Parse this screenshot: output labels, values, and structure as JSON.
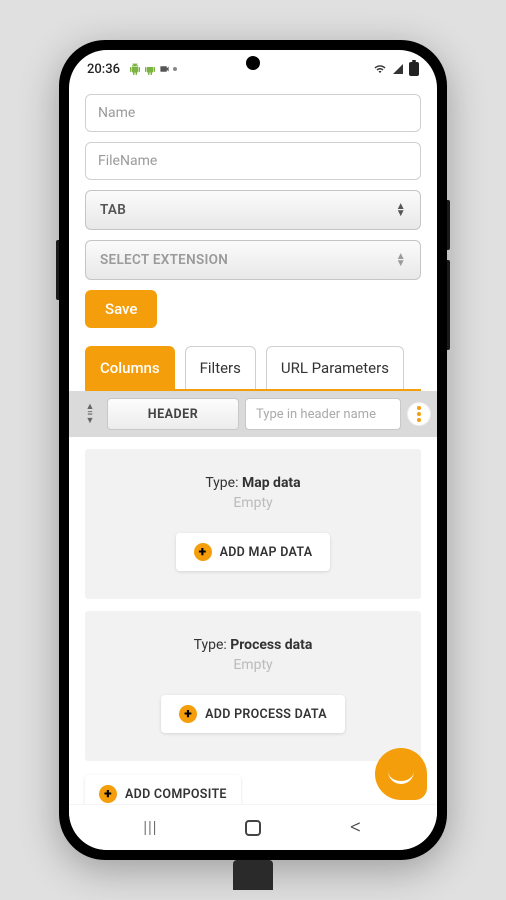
{
  "statusBar": {
    "time": "20:36"
  },
  "form": {
    "name_placeholder": "Name",
    "filename_placeholder": "FileName",
    "tab_select": "TAB",
    "extension_select": "SELECT EXTENSION",
    "save_label": "Save"
  },
  "tabs": {
    "columns": "Columns",
    "filters": "Filters",
    "url_params": "URL Parameters"
  },
  "header_row": {
    "header_btn": "HEADER",
    "header_placeholder": "Type in header name"
  },
  "sections": {
    "map": {
      "type_prefix": "Type: ",
      "type_value": "Map data",
      "empty": "Empty",
      "add_label": "ADD MAP DATA"
    },
    "process": {
      "type_prefix": "Type: ",
      "type_value": "Process data",
      "empty": "Empty",
      "add_label": "ADD PROCESS DATA"
    },
    "composite_label": "ADD COMPOSITE"
  }
}
